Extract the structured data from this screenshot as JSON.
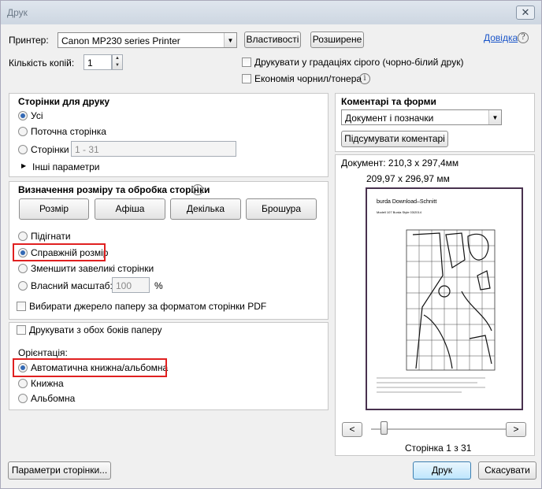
{
  "window": {
    "title": "Друк",
    "close_glyph": "✕"
  },
  "printer": {
    "label": "Принтер:",
    "selected": "Canon MP230 series Printer",
    "properties_button": "Властивості",
    "advanced_button": "Розширене",
    "help_link": "Довідка"
  },
  "copies": {
    "label": "Кількість копій:",
    "value": "1"
  },
  "options": {
    "grayscale": "Друкувати у градаціях сірого (чорно-білий друк)",
    "save_ink": "Економія чорнил/тонера"
  },
  "pages": {
    "title": "Сторінки для друку",
    "all": "Усі",
    "current": "Поточна сторінка",
    "pages_label": "Сторінки",
    "range_placeholder": "1 - 31",
    "more": "Інші параметри"
  },
  "sizing": {
    "title": "Визначення розміру та обробка сторінки",
    "buttons": [
      "Розмір",
      "Афіша",
      "Декілька",
      "Брошура"
    ],
    "fit": "Підігнати",
    "actual": "Справжній розмір",
    "shrink": "Зменшити завеликі сторінки",
    "custom": "Власний масштаб:",
    "custom_value": "100",
    "percent": "%",
    "source_by_size": "Вибирати джерело паперу за форматом сторінки PDF"
  },
  "duplex": {
    "label": "Друкувати з обох боків паперу"
  },
  "orientation": {
    "title": "Орієнтація:",
    "auto": "Автоматична книжна/альбомна",
    "portrait": "Книжна",
    "landscape": "Альбомна"
  },
  "comments": {
    "title": "Коментарі та форми",
    "selected": "Документ і позначки",
    "summarize_button": "Підсумувати коментарі"
  },
  "preview": {
    "document_size": "Документ: 210,3 x 297,4мм",
    "page_size": "209,97 x 296,97 мм",
    "page_header": "burda Download–Schnitt",
    "page_subheader": "Modell 107 Burda Style 03/2014",
    "page_counter": "Сторінка 1 з 31",
    "prev_glyph": "<",
    "next_glyph": ">"
  },
  "footer": {
    "page_setup_button": "Параметри сторінки...",
    "print_button": "Друк",
    "cancel_button": "Скасувати"
  },
  "colors": {
    "highlight": "#e02020",
    "preview_border": "#48314e",
    "link": "#1a55c9"
  }
}
